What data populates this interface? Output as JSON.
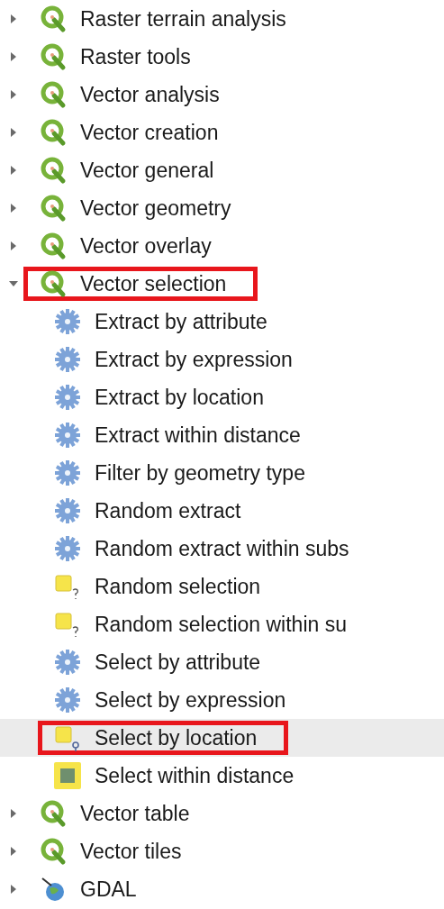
{
  "tree": [
    {
      "label": "Raster terrain analysis",
      "kind": "qgis",
      "expanded": false,
      "selected": false,
      "highlighted": false
    },
    {
      "label": "Raster tools",
      "kind": "qgis",
      "expanded": false,
      "selected": false,
      "highlighted": false
    },
    {
      "label": "Vector analysis",
      "kind": "qgis",
      "expanded": false,
      "selected": false,
      "highlighted": false
    },
    {
      "label": "Vector creation",
      "kind": "qgis",
      "expanded": false,
      "selected": false,
      "highlighted": false
    },
    {
      "label": "Vector general",
      "kind": "qgis",
      "expanded": false,
      "selected": false,
      "highlighted": false
    },
    {
      "label": "Vector geometry",
      "kind": "qgis",
      "expanded": false,
      "selected": false,
      "highlighted": false
    },
    {
      "label": "Vector overlay",
      "kind": "qgis",
      "expanded": false,
      "selected": false,
      "highlighted": false
    },
    {
      "label": "Vector selection",
      "kind": "qgis",
      "expanded": true,
      "selected": false,
      "highlighted": true,
      "children": [
        {
          "label": "Extract by attribute",
          "kind": "gear",
          "selected": false,
          "highlighted": false
        },
        {
          "label": "Extract by expression",
          "kind": "gear",
          "selected": false,
          "highlighted": false
        },
        {
          "label": "Extract by location",
          "kind": "gear",
          "selected": false,
          "highlighted": false
        },
        {
          "label": "Extract within distance",
          "kind": "gear",
          "selected": false,
          "highlighted": false
        },
        {
          "label": "Filter by geometry type",
          "kind": "gear",
          "selected": false,
          "highlighted": false
        },
        {
          "label": "Random extract",
          "kind": "gear",
          "selected": false,
          "highlighted": false
        },
        {
          "label": "Random extract within subs",
          "kind": "gear",
          "selected": false,
          "highlighted": false
        },
        {
          "label": "Random selection",
          "kind": "select-random",
          "selected": false,
          "highlighted": false
        },
        {
          "label": "Random selection within su",
          "kind": "select-random",
          "selected": false,
          "highlighted": false
        },
        {
          "label": "Select by attribute",
          "kind": "gear",
          "selected": false,
          "highlighted": false
        },
        {
          "label": "Select by expression",
          "kind": "gear",
          "selected": false,
          "highlighted": false
        },
        {
          "label": "Select by location",
          "kind": "select-location",
          "selected": true,
          "highlighted": true
        },
        {
          "label": "Select within distance",
          "kind": "select-distance",
          "selected": false,
          "highlighted": false
        }
      ]
    },
    {
      "label": "Vector table",
      "kind": "qgis",
      "expanded": false,
      "selected": false,
      "highlighted": false
    },
    {
      "label": "Vector tiles",
      "kind": "qgis",
      "expanded": false,
      "selected": false,
      "highlighted": false
    },
    {
      "label": "GDAL",
      "kind": "gdal",
      "expanded": false,
      "selected": false,
      "highlighted": false
    }
  ]
}
